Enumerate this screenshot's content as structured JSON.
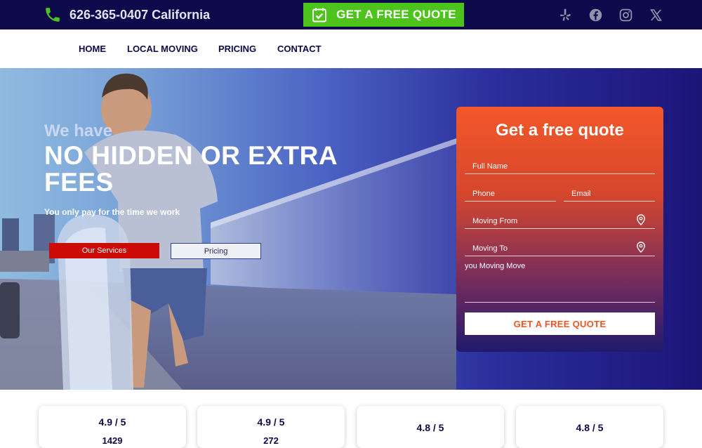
{
  "topbar": {
    "phone_text": "626-365-0407 California",
    "cta_label": "GET A FREE QUOTE",
    "socials": [
      "yelp-icon",
      "facebook-icon",
      "instagram-icon",
      "x-icon"
    ]
  },
  "nav": {
    "items": [
      {
        "label": "HOME"
      },
      {
        "label": "LOCAL MOVING"
      },
      {
        "label": "PRICING"
      },
      {
        "label": "CONTACT"
      }
    ]
  },
  "hero": {
    "kicker": "We have",
    "title": "NO HIDDEN OR EXTRA FEES",
    "subtitle": "You only pay for the time we work",
    "services_label": "Our Services",
    "pricing_label": "Pricing"
  },
  "form": {
    "title": "Get a free quote",
    "full_name_placeholder": "Full Name",
    "phone_placeholder": "Phone",
    "email_placeholder": "Email",
    "from_placeholder": "Moving From",
    "to_placeholder": "Moving To",
    "message_placeholder": "you Moving Move",
    "submit_label": "GET A FREE QUOTE"
  },
  "ratings": [
    {
      "score": "4.9 / 5",
      "count": "1429"
    },
    {
      "score": "4.9 / 5",
      "count": "272"
    },
    {
      "score": "4.8 / 5",
      "count": ""
    },
    {
      "score": "4.8 / 5",
      "count": ""
    }
  ],
  "colors": {
    "navy": "#0c0a4a",
    "cta_green": "#4cc41c",
    "accent_orange": "#ee5524",
    "services_red": "#cc0b06"
  }
}
